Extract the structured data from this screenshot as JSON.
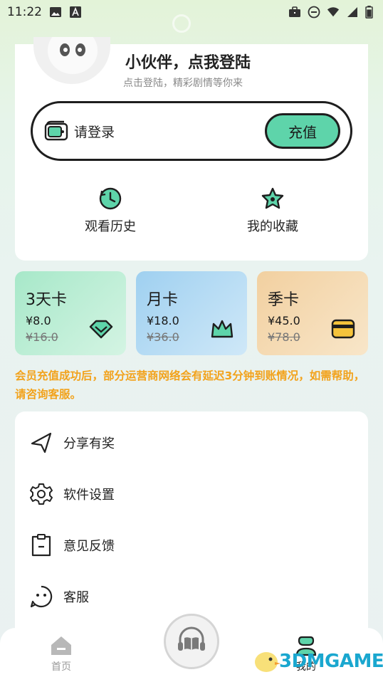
{
  "status_bar": {
    "time": "11:22",
    "icons_left": [
      "image-icon",
      "a-font-icon"
    ],
    "icons_right": [
      "briefcase-icon",
      "do-not-disturb-icon",
      "wifi-icon",
      "signal-icon",
      "battery-icon"
    ]
  },
  "profile": {
    "name": "小伙伴，点我登陆",
    "subtitle": "点击登陆，精彩剧情等你来",
    "avatar_icon": "panda-avatar-icon"
  },
  "wallet": {
    "label": "请登录",
    "recharge_label": "充值",
    "icon": "wallet-icon"
  },
  "quick_actions": [
    {
      "label": "观看历史",
      "icon": "history-clock-icon"
    },
    {
      "label": "我的收藏",
      "icon": "star-favorite-icon"
    }
  ],
  "vip_cards": [
    {
      "title": "3天卡",
      "price": "¥8.0",
      "original_price": "¥16.0",
      "icon": "diamond-icon",
      "color": "#b9ecd3"
    },
    {
      "title": "月卡",
      "price": "¥18.0",
      "original_price": "¥36.0",
      "icon": "crown-icon",
      "color": "#b6dcf2"
    },
    {
      "title": "季卡",
      "price": "¥45.0",
      "original_price": "¥78.0",
      "icon": "card-icon",
      "color": "#f5dcb6"
    }
  ],
  "notice": "会员充值成功后，部分运营商网络会有延迟3分钟到账情况，如需帮助，请咨询客服。",
  "menu": [
    {
      "label": "分享有奖",
      "icon": "share-arrow-icon"
    },
    {
      "label": "软件设置",
      "icon": "gear-icon"
    },
    {
      "label": "意见反馈",
      "icon": "clipboard-icon"
    },
    {
      "label": "客服",
      "icon": "chat-face-icon"
    }
  ],
  "bottom_nav": {
    "tabs": [
      {
        "label": "首页",
        "icon": "home-icon"
      },
      {
        "label": "我的",
        "icon": "person-icon"
      }
    ],
    "center_icon": "headphone-book-icon"
  },
  "watermark": "3DMGAME",
  "colors": {
    "accent": "#5ed4aa",
    "notice": "#f2a21b",
    "watermark": "#1aa7cf"
  }
}
